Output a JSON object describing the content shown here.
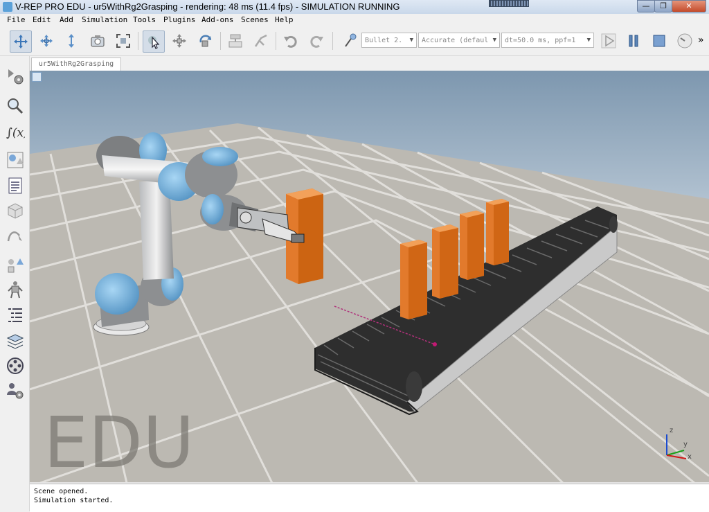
{
  "window": {
    "title": "V-REP PRO EDU - ur5WithRg2Grasping - rendering: 48 ms (11.4 fps) - SIMULATION RUNNING",
    "minimize": "—",
    "maximize": "❐",
    "close": "✕"
  },
  "menu": [
    "File",
    "Edit",
    "Add",
    "Simulation",
    "Tools",
    "Plugins",
    "Add-ons",
    "Scenes",
    "Help"
  ],
  "toolbar": {
    "engine": "Bullet 2.",
    "accuracy": "Accurate (defaul",
    "timestep": "dt=50.0 ms, ppf=1",
    "overflow": "»"
  },
  "tabs": [
    "ur5WithRg2Grasping"
  ],
  "scene": {
    "watermark": "EDU",
    "axis_x": "x",
    "axis_y": "y",
    "axis_z": "z"
  },
  "console": [
    "Scene opened.",
    "Simulation started."
  ],
  "colors": {
    "sky_top": "#7f98b0",
    "sky_bottom": "#d7e0e9",
    "floor": "#bdbab3",
    "cube": "#e27a2c",
    "robot_blue": "#6fb0dd",
    "robot_grey": "#8c8d8f"
  }
}
